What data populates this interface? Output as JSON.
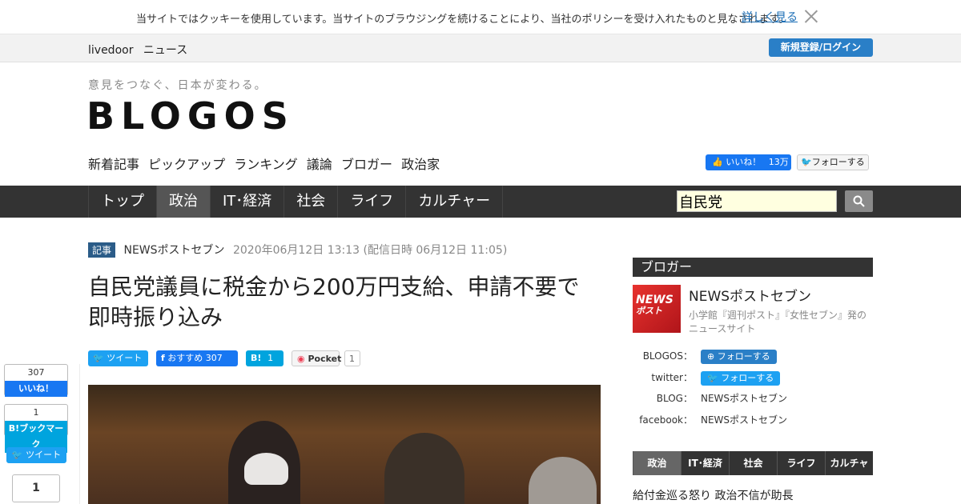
{
  "cookie": {
    "message": "当サイトではクッキーを使用しています。当サイトのブラウジングを続けることにより、当社のポリシーを受け入れたものと見なされます。",
    "more_link": "詳しく見る"
  },
  "topbar": {
    "site_1": "livedoor",
    "site_2": "ニュース",
    "login": "新規登録/ログイン"
  },
  "header": {
    "tagline": "意見をつなぐ、日本が変わる。",
    "logo": "BLOGOS",
    "subnav": [
      "新着記事",
      "ピックアップ",
      "ランキング",
      "議論",
      "ブロガー",
      "政治家"
    ],
    "fb_like": "いいね！",
    "fb_like_count": "13万",
    "follow": "フォローする"
  },
  "mainnav": {
    "tabs": [
      "トップ",
      "政治",
      "IT･経済",
      "社会",
      "ライフ",
      "カルチャー"
    ],
    "active": "政治",
    "search_value": "自民党"
  },
  "article": {
    "tag": "記事",
    "source": "NEWSポストセブン",
    "date": "2020年06月12日 13:13 (配信日時 06月12日 11:05)",
    "headline": "自民党議員に税金から200万円支給、申請不要で即時振り込み",
    "share": {
      "tweet": "ツイート",
      "fb": "おすすめ",
      "fb_count": "307",
      "hatena": "B!",
      "hatena_count": "1",
      "pocket": "Pocket",
      "pocket_count": "1"
    }
  },
  "leftbar": {
    "fb_count": "307",
    "fb_label": "いいね！",
    "hatena_count": "1",
    "hatena_label": "B!ブックマーク",
    "tweet": "ツイート",
    "pocket_count": "1"
  },
  "sidebar": {
    "heading": "ブロガー",
    "avatar_text_1": "NEWS",
    "avatar_text_2": "ポスト",
    "name": "NEWSポストセブン",
    "desc": "小学館『週刊ポスト』『女性セブン』発のニュースサイト",
    "info": [
      {
        "key": "BLOGOS：",
        "value": "フォローする",
        "type": "follow"
      },
      {
        "key": "twitter：",
        "value": "フォローする",
        "type": "follow"
      },
      {
        "key": "BLOG：",
        "value": "NEWSポストセブン",
        "type": "text"
      },
      {
        "key": "facebook：",
        "value": "NEWSポストセブン",
        "type": "text"
      }
    ],
    "categories": [
      "政治",
      "IT･経済",
      "社会",
      "ライフ",
      "カルチャー"
    ],
    "news_1": "給付金巡る怒り 政治不信が助長"
  },
  "colors": {
    "nav_bg": "#333333",
    "accent_blue": "#2a7fc7",
    "fb": "#1877f2",
    "twitter": "#1da1f2",
    "hatena": "#00a4de",
    "pocket": "#ef4056"
  }
}
